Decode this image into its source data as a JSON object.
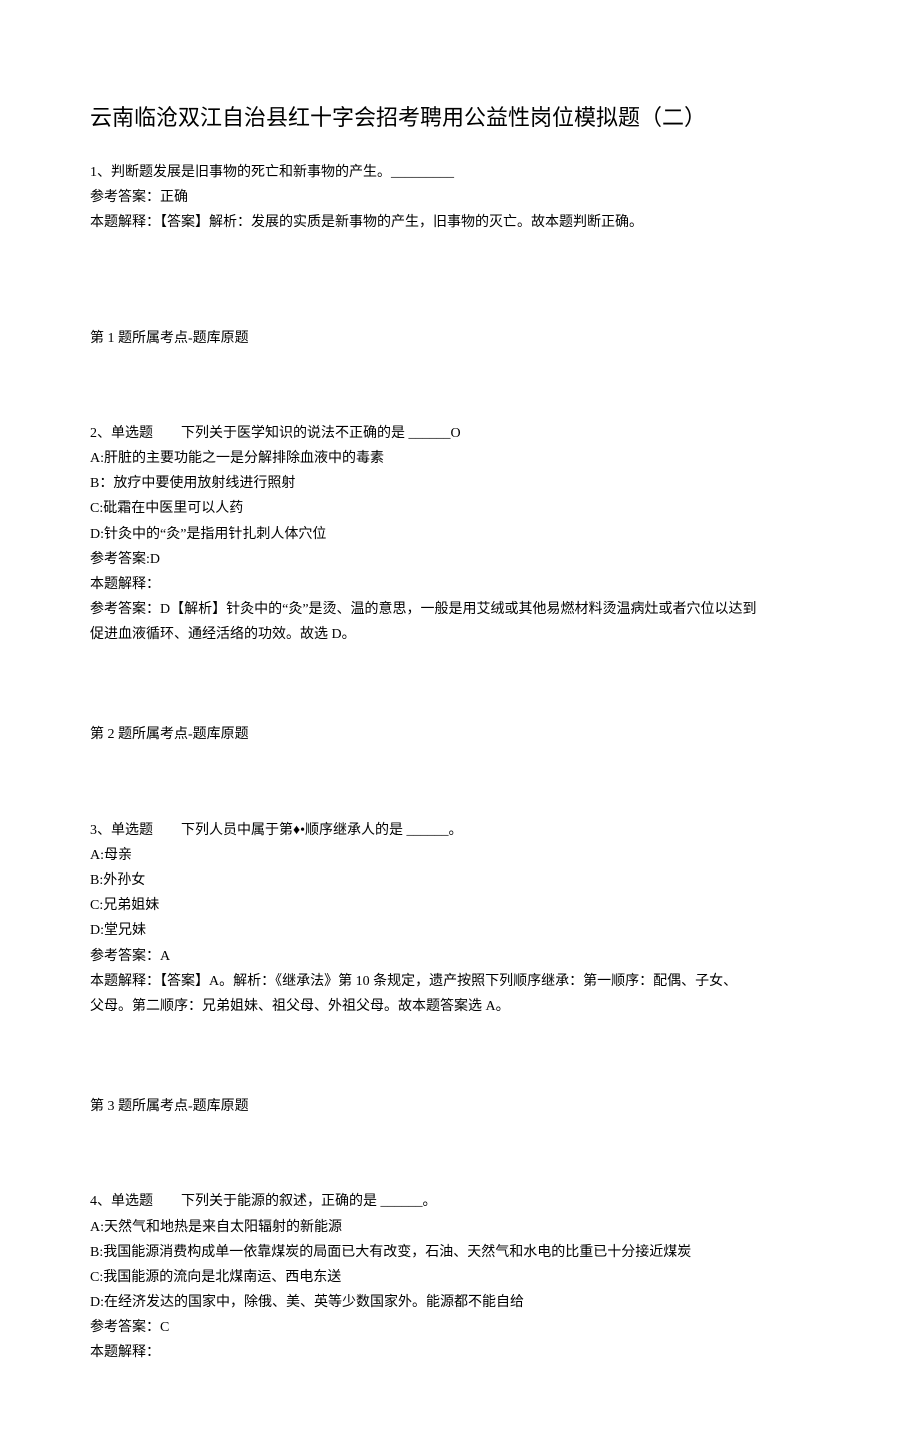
{
  "title": "云南临沧双江自治县红十字会招考聘用公益性岗位模拟题（二）",
  "q1": {
    "stem": "1、判断题发展是旧事物的死亡和新事物的产生。_________",
    "answer": "参考答案：正确",
    "explain": "本题解释：【答案】解析：发展的实质是新事物的产生，旧事物的灭亡。故本题判断正确。",
    "meta": "第 1 题所属考点-题库原题"
  },
  "q2": {
    "stem": "2、单选题　　下列关于医学知识的说法不正确的是 ______O",
    "a": "A:肝脏的主要功能之一是分解排除血液中的毒素",
    "b": "B：放疗中要使用放射线进行照射",
    "c": "C:砒霜在中医里可以人药",
    "d": "D:针灸中的“灸”是指用针扎刺人体穴位",
    "answer": "参考答案:D",
    "explainLabel": "本题解释：",
    "explain1": "参考答案：D【解析】针灸中的“灸”是烫、温的意思，一般是用艾绒或其他易燃材料烫温病灶或者穴位以达到",
    "explain2": "促进血液循环、通经活络的功效。故选 D。",
    "meta": "第 2 题所属考点-题库原题"
  },
  "q3": {
    "stem": "3、单选题　　下列人员中属于第♦•顺序继承人的是 ______。",
    "a": "A:母亲",
    "b": "B:外孙女",
    "c": "C:兄弟姐妹",
    "d": "D:堂兄妹",
    "answer": "参考答案：A",
    "explain1": "本题解释：【答案】A。解析：《继承法》第 10 条规定，遗产按照下列顺序继承：第一顺序：配偶、子女、",
    "explain2": "父母。第二顺序：兄弟姐妹、祖父母、外祖父母。故本题答案选 A。",
    "meta": "第 3 题所属考点-题库原题"
  },
  "q4": {
    "stem": "4、单选题　　下列关于能源的叙述，正确的是 ______。",
    "a": "A:天然气和地热是来自太阳辐射的新能源",
    "b": "B:我国能源消费构成单一依靠煤炭的局面已大有改变，石油、天然气和水电的比重已十分接近煤炭",
    "c": "C:我国能源的流向是北煤南运、西电东送",
    "d": "D:在经济发达的国家中，除俄、美、英等少数国家外。能源都不能自给",
    "answer": "参考答案：C",
    "explainLabel": "本题解释："
  }
}
